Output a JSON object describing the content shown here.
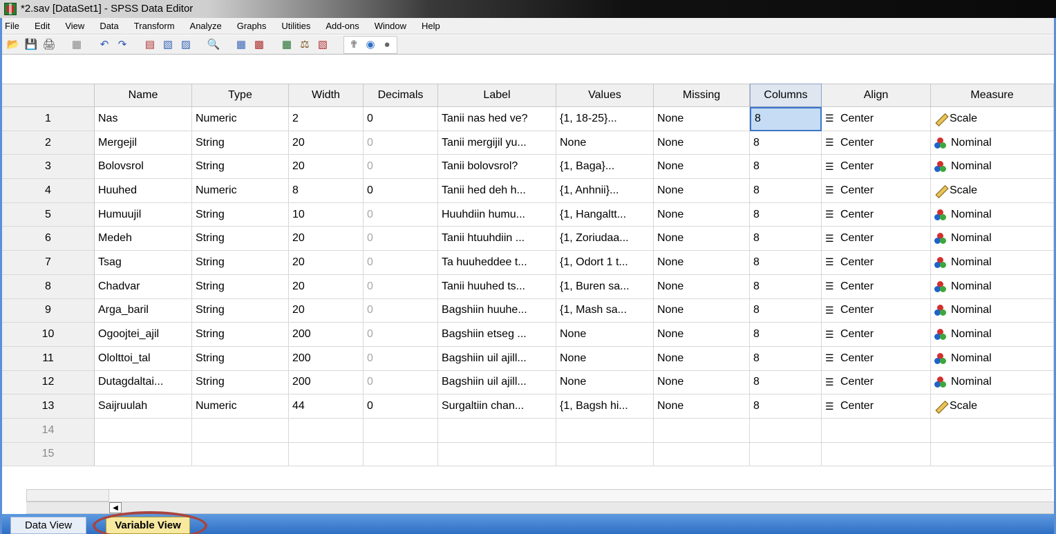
{
  "window": {
    "title": "*2.sav [DataSet1] - SPSS Data Editor"
  },
  "menu": [
    {
      "label": "File"
    },
    {
      "label": "Edit"
    },
    {
      "label": "View"
    },
    {
      "label": "Data"
    },
    {
      "label": "Transform"
    },
    {
      "label": "Analyze"
    },
    {
      "label": "Graphs"
    },
    {
      "label": "Utilities"
    },
    {
      "label": "Add-ons"
    },
    {
      "label": "Window"
    },
    {
      "label": "Help"
    }
  ],
  "toolbar": {
    "icons": [
      "open-icon",
      "save-icon",
      "print-icon",
      "dialog-recall-icon",
      "undo-icon",
      "redo-icon",
      "goto-case-icon",
      "goto-variable-icon",
      "variables-icon",
      "find-icon",
      "insert-cases-icon",
      "insert-variable-icon",
      "split-file-icon",
      "weight-cases-icon",
      "select-cases-icon",
      "value-labels-icon",
      "use-sets-icon",
      "show-all-variables-icon"
    ]
  },
  "table": {
    "headers": [
      "",
      "Name",
      "Type",
      "Width",
      "Decimals",
      "Label",
      "Values",
      "Missing",
      "Columns",
      "Align",
      "Measure"
    ],
    "rows": [
      {
        "n": "1",
        "name": "Nas",
        "type": "Numeric",
        "width": "2",
        "decimals": "0",
        "label": "Tanii nas hed ve?",
        "values": "{1, 18-25}...",
        "missing": "None",
        "columns": "8",
        "align": "Center",
        "measure": "Scale"
      },
      {
        "n": "2",
        "name": "Mergejil",
        "type": "String",
        "width": "20",
        "decimals": "0",
        "label": "Tanii mergijil yu...",
        "values": "None",
        "missing": "None",
        "columns": "8",
        "align": "Center",
        "measure": "Nominal"
      },
      {
        "n": "3",
        "name": "Bolovsrol",
        "type": "String",
        "width": "20",
        "decimals": "0",
        "label": "Tanii bolovsrol?",
        "values": "{1, Baga}...",
        "missing": "None",
        "columns": "8",
        "align": "Center",
        "measure": "Nominal"
      },
      {
        "n": "4",
        "name": "Huuhed",
        "type": "Numeric",
        "width": "8",
        "decimals": "0",
        "label": "Tanii hed deh h...",
        "values": "{1, Anhnii}...",
        "missing": "None",
        "columns": "8",
        "align": "Center",
        "measure": "Scale"
      },
      {
        "n": "5",
        "name": "Humuujil",
        "type": "String",
        "width": "10",
        "decimals": "0",
        "label": "Huuhdiin humu...",
        "values": "{1, Hangaltt...",
        "missing": "None",
        "columns": "8",
        "align": "Center",
        "measure": "Nominal"
      },
      {
        "n": "6",
        "name": "Medeh",
        "type": "String",
        "width": "20",
        "decimals": "0",
        "label": "Tanii htuuhdiin ...",
        "values": "{1, Zoriudaa...",
        "missing": "None",
        "columns": "8",
        "align": "Center",
        "measure": "Nominal"
      },
      {
        "n": "7",
        "name": "Tsag",
        "type": "String",
        "width": "20",
        "decimals": "0",
        "label": "Ta huuheddee t...",
        "values": "{1, Odort 1 t...",
        "missing": "None",
        "columns": "8",
        "align": "Center",
        "measure": "Nominal"
      },
      {
        "n": "8",
        "name": "Chadvar",
        "type": "String",
        "width": "20",
        "decimals": "0",
        "label": "Tanii huuhed ts...",
        "values": "{1, Buren sa...",
        "missing": "None",
        "columns": "8",
        "align": "Center",
        "measure": "Nominal"
      },
      {
        "n": "9",
        "name": "Arga_baril",
        "type": "String",
        "width": "20",
        "decimals": "0",
        "label": "Bagshiin huuhe...",
        "values": "{1, Mash sa...",
        "missing": "None",
        "columns": "8",
        "align": "Center",
        "measure": "Nominal"
      },
      {
        "n": "10",
        "name": "Ogoojtei_ajil",
        "type": "String",
        "width": "200",
        "decimals": "0",
        "label": "Bagshiin etseg ...",
        "values": "None",
        "missing": "None",
        "columns": "8",
        "align": "Center",
        "measure": "Nominal"
      },
      {
        "n": "11",
        "name": "Ololttoi_tal",
        "type": "String",
        "width": "200",
        "decimals": "0",
        "label": "Bagshiin uil ajill...",
        "values": "None",
        "missing": "None",
        "columns": "8",
        "align": "Center",
        "measure": "Nominal"
      },
      {
        "n": "12",
        "name": "Dutagdaltai...",
        "type": "String",
        "width": "200",
        "decimals": "0",
        "label": "Bagshiin uil ajill...",
        "values": "None",
        "missing": "None",
        "columns": "8",
        "align": "Center",
        "measure": "Nominal"
      },
      {
        "n": "13",
        "name": "Saijruulah",
        "type": "Numeric",
        "width": "44",
        "decimals": "0",
        "label": "Surgaltiin chan...",
        "values": "{1, Bagsh hi...",
        "missing": "None",
        "columns": "8",
        "align": "Center",
        "measure": "Scale"
      }
    ],
    "empty_rows": [
      "14",
      "15"
    ],
    "selected_cell": {
      "row": 1,
      "column": "Columns"
    }
  },
  "tabs": {
    "data_view": "Data View",
    "variable_view": "Variable View",
    "active": "Variable View"
  },
  "colors": {
    "title_gradient_dark": "#0a0a0a",
    "tab_bar": "#2f6fc4",
    "active_tab": "#f7e9a0",
    "selection": "#c5dcf4",
    "highlight_circle": "#a8453f"
  }
}
